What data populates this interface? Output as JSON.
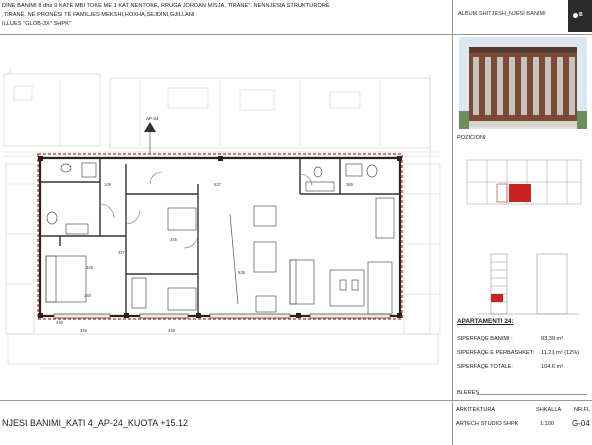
{
  "header": {
    "lines": [
      "DINE BANIMI 8 dhe 9 KATE MBI TOKE ME 1 KAT NENTOKE, RRUGA JORDAN MISJA, TIRANE\". NENNJESIA STRUKTURORE",
      ",TIRANË. NË PRONËSI TË FAMILJES MEKSHI,HOXHA,SEJDINI,GJILLANI",
      "ILLUES \"GLOB-3X\" SHPK\""
    ],
    "album": "ALBUM SHITJESH_NJESI BANIMI",
    "logo_text": "B"
  },
  "plan": {
    "unit_tag": "AP-24",
    "dims": {
      "d106": "106",
      "d637": "637",
      "d385": "385",
      "d345a": "345",
      "d345b": "345",
      "d340": "340",
      "d326": "326",
      "d340b": "340",
      "d417": "417",
      "d536": "536",
      "d340c": "340"
    }
  },
  "right": {
    "pozicioni": "POZICIONI",
    "apt_title": "APARTAMENTI 24:",
    "rows": [
      {
        "label": "SIPERFAQE BANIMI :",
        "value": "93.39 m²"
      },
      {
        "label": "SIPERFAQE E PERBASHKET:",
        "value": "11.21 m² (12%)"
      },
      {
        "label": "SIPERFAQE TOTALE:",
        "value": "104.6 m²"
      }
    ],
    "bleres": "BLERES"
  },
  "footer": {
    "title": "NJESI BANIMI_KATI 4_AP-24_KUOTA +15.12",
    "arkitektura_label": "ARKITEKTURA",
    "arkitektura_value": "ARTECH STUDIO SHPK",
    "shkalla_label": "SHKALLA",
    "shkalla_value": "1:100",
    "nr_label": "NR.FL",
    "nr_value": "G-04"
  },
  "colors": {
    "accent_red": "#cc2222",
    "brand_dark": "#2b2b2b"
  }
}
